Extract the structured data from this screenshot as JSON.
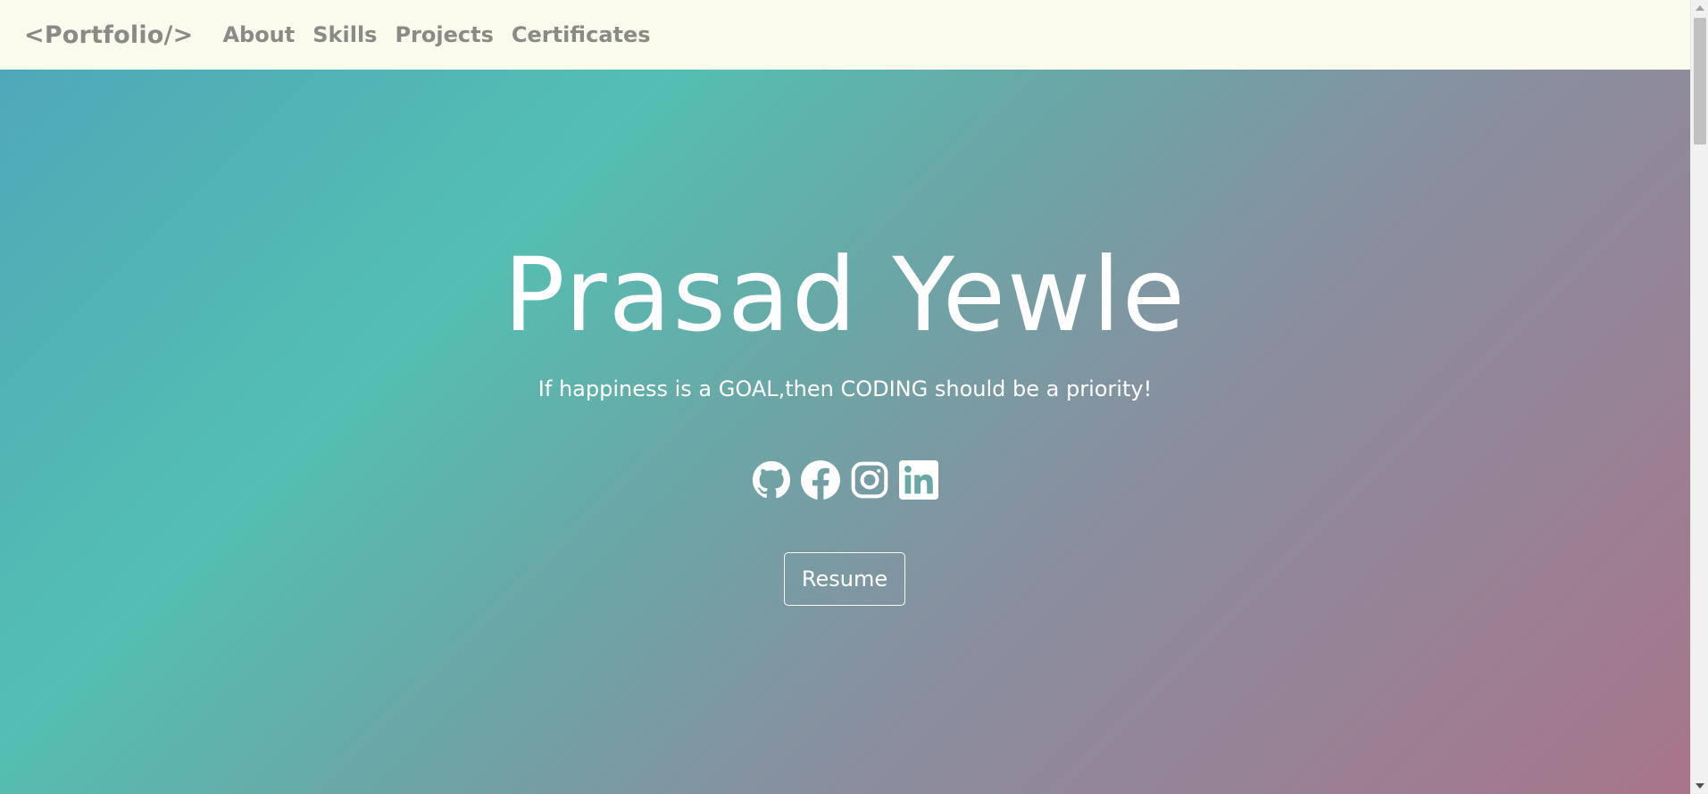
{
  "navbar": {
    "brand": "<Portfolio/>",
    "links": [
      {
        "label": "About"
      },
      {
        "label": "Skills"
      },
      {
        "label": "Projects"
      },
      {
        "label": "Certificates"
      }
    ]
  },
  "hero": {
    "name": "Prasad Yewle",
    "tagline": "If happiness is a GOAL,then CODING should be a priority!",
    "socials": [
      {
        "icon": "github-icon"
      },
      {
        "icon": "facebook-icon"
      },
      {
        "icon": "instagram-icon"
      },
      {
        "icon": "linkedin-icon"
      }
    ],
    "resume_label": "Resume"
  },
  "colors": {
    "navbar_bg": "#fafbec",
    "nav_text": "#8a8a86",
    "hero_gradient_start": "#4fa8b9",
    "hero_gradient_mid": "#54bfb2",
    "hero_gradient_end": "#a8758b",
    "hero_text": "#ffffff"
  }
}
